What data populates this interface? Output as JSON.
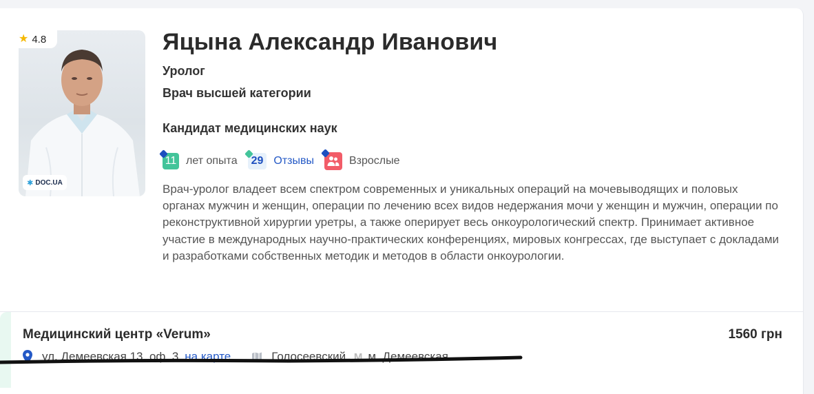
{
  "doctor": {
    "name": "Яцына Александр Иванович",
    "specialty": "Уролог",
    "category": "Врач высшей категории",
    "degree": "Кандидат медицинских наук",
    "rating": "4.8",
    "photo_badge": "DOC.UA"
  },
  "stats": {
    "experience_value": "11",
    "experience_label": "лет опыта",
    "reviews_value": "29",
    "reviews_label": "Отзывы",
    "patients_label": "Взрослые"
  },
  "description": "Врач-уролог владеет всем спектром современных и уникальных операций на мочевыводящих и половых органах мужчин и женщин, операции по лечению всех видов недержания мочи у женщин и мужчин, операции по реконструктивной хирургии уретры, а также оперирует весь онкоурологический спектр. Принимает активное участие в международных научно-практических конференциях, мировых конгрессах, где выступает с докладами и разработками собственных методик и методов в области онкоурологии.",
  "clinic": {
    "name": "Медицинский центр «Verum»",
    "price": "1560 грн",
    "address": "ул. Демеевская 13, оф. 3",
    "map_link": "на карте",
    "district": "Голосеевский,",
    "metro": "м. Демеевская"
  },
  "colors": {
    "accent_blue": "#2459c6",
    "experience_green": "#43c49a",
    "adult_red": "#f25c68",
    "star": "#f5b800"
  }
}
